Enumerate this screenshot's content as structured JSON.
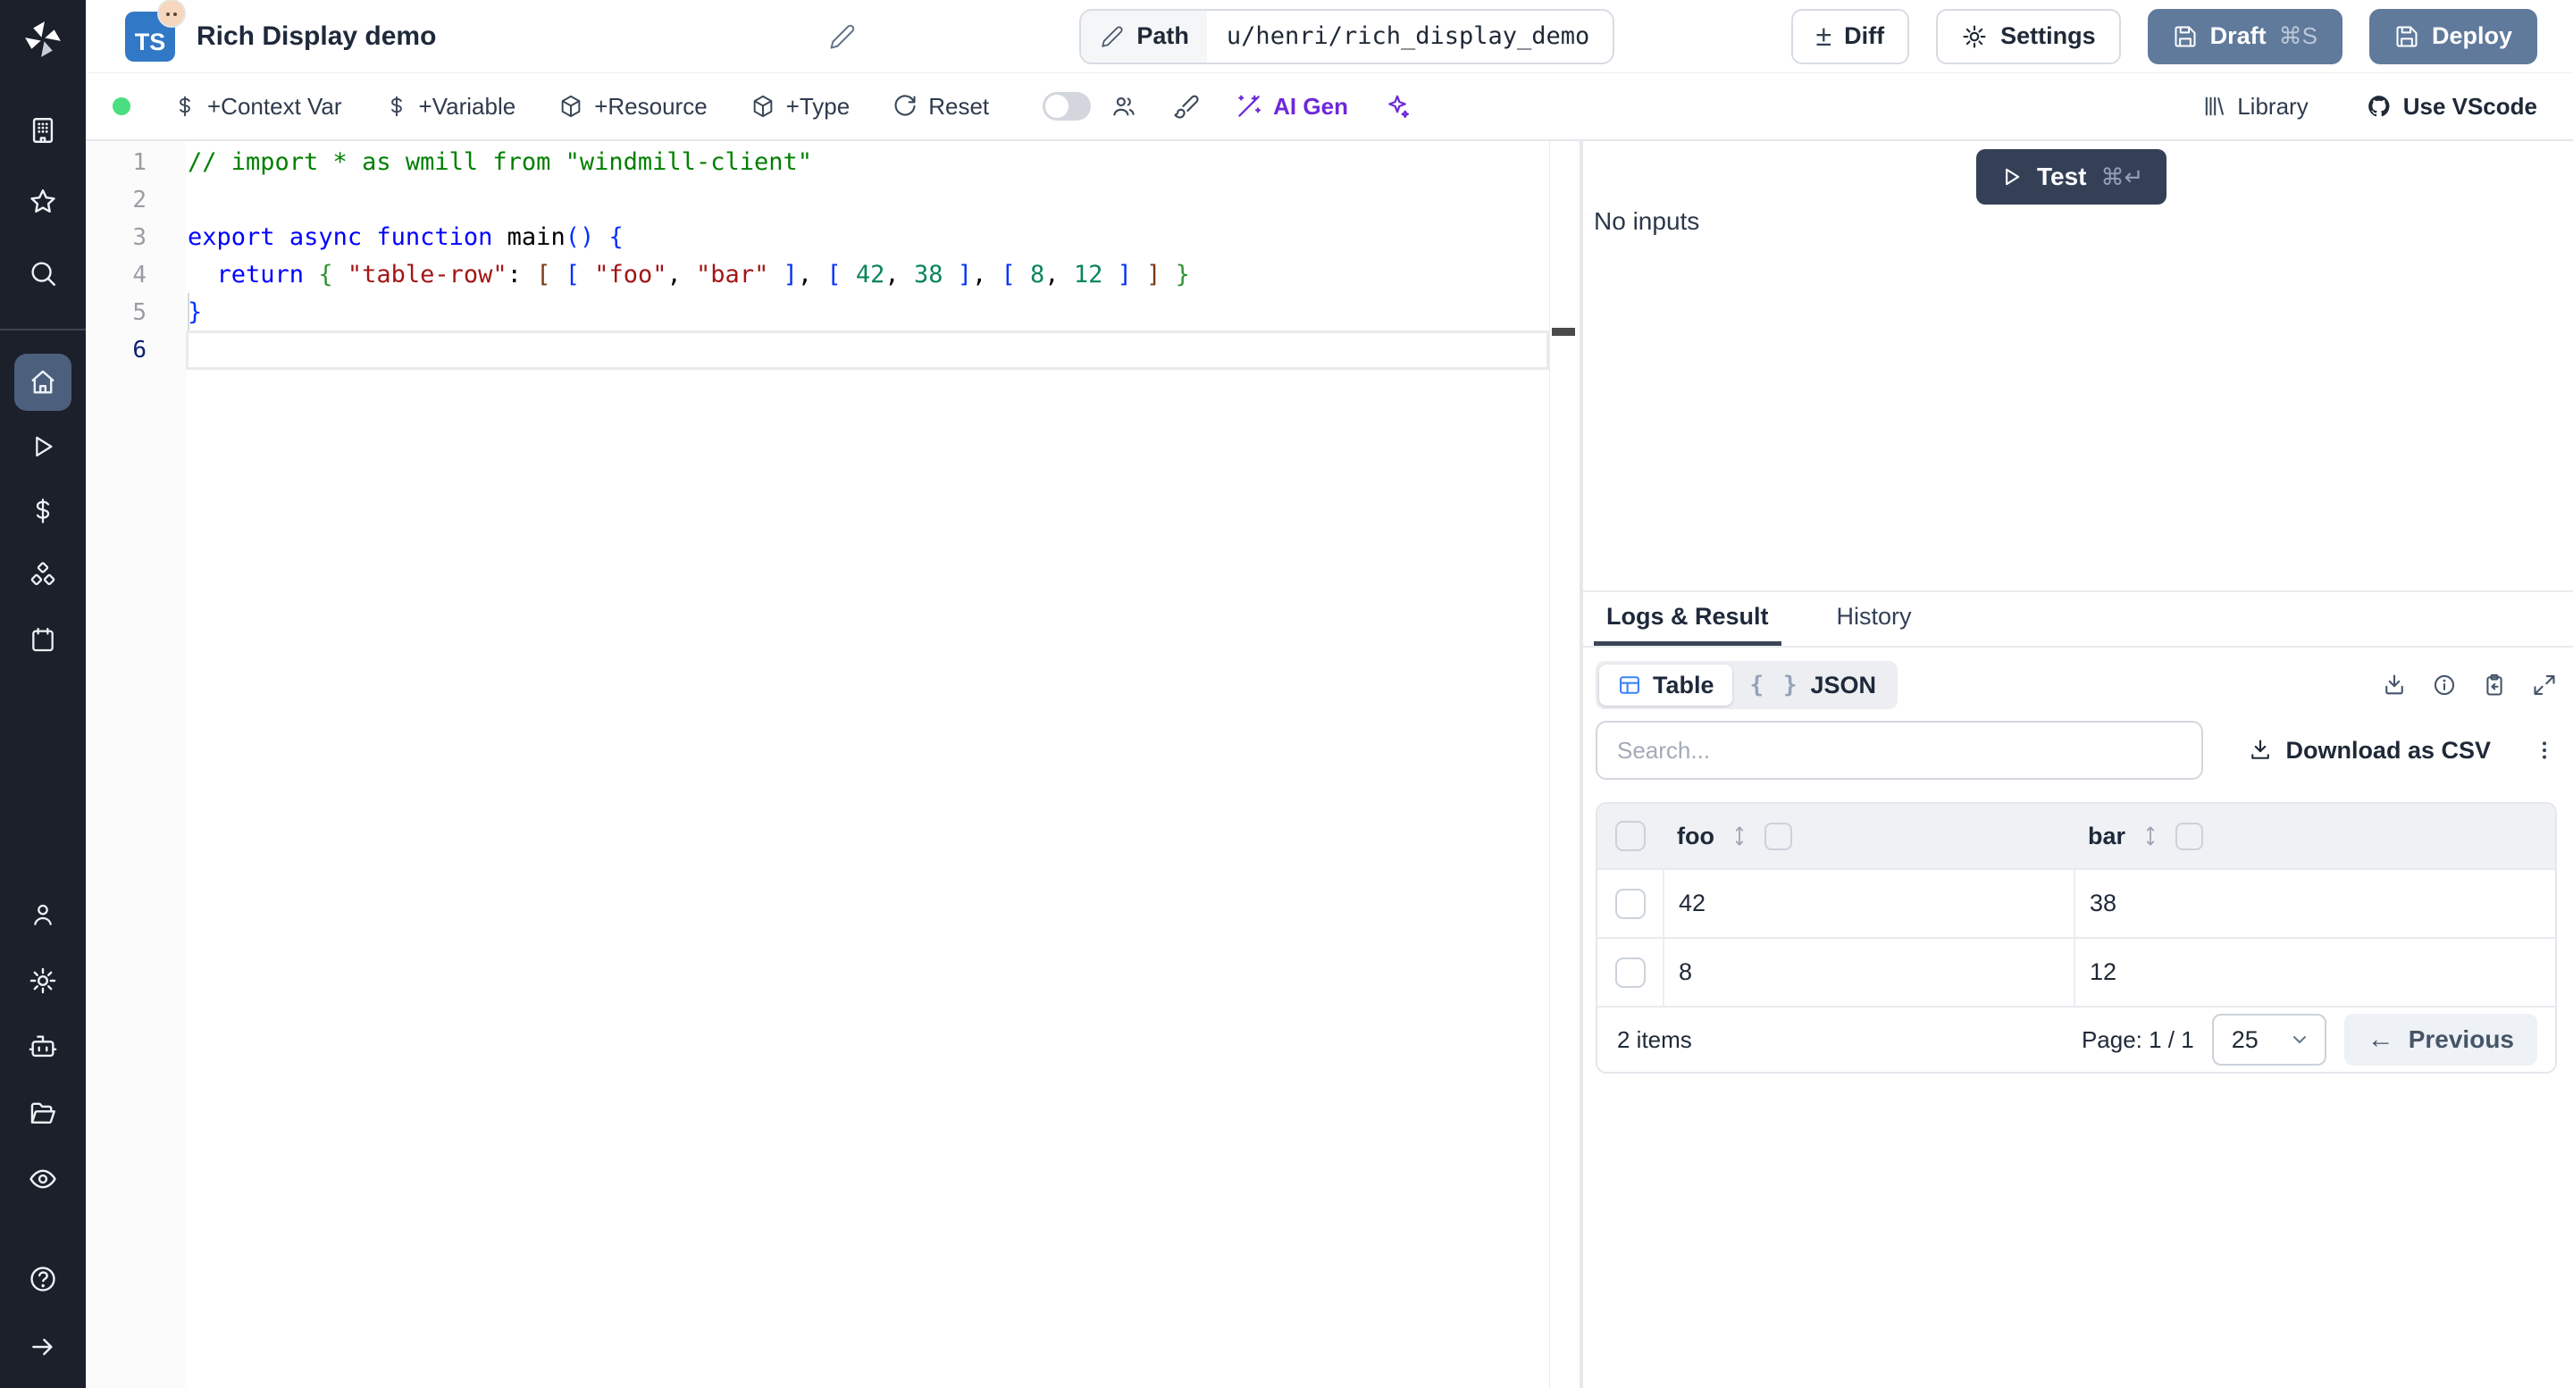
{
  "topbar": {
    "language_badge": "TS",
    "title": "Rich Display demo",
    "path_label": "Path",
    "path_value": "u/henri/rich_display_demo",
    "diff_label": "Diff",
    "settings_label": "Settings",
    "draft_label": "Draft",
    "draft_shortcut": "⌘S",
    "deploy_label": "Deploy"
  },
  "toolbar": {
    "status_color": "#4ade80",
    "context_var_label": "+Context Var",
    "variable_label": "+Variable",
    "resource_label": "+Resource",
    "type_label": "+Type",
    "reset_label": "Reset",
    "ai_gen_label": "AI Gen",
    "ai_accent_color": "#6d28d9",
    "library_label": "Library",
    "vscode_label": "Use VScode"
  },
  "sidebar": {
    "icons": [
      "windmill-logo",
      "building",
      "star",
      "search",
      "home",
      "play",
      "boxes",
      "dollar",
      "calendar",
      "user",
      "gear",
      "bot",
      "folder-open",
      "eye",
      "help-circle",
      "arrow-right"
    ],
    "active_item": "home",
    "active_color": "#4c5f7d"
  },
  "editor": {
    "line_numbers": [
      "1",
      "2",
      "3",
      "4",
      "5",
      "6"
    ],
    "active_line": "6",
    "lines": [
      [
        {
          "t": "// import * as wmill from \"windmill-client\"",
          "c": "tok-comment"
        }
      ],
      [],
      [
        {
          "t": "export",
          "c": "tok-kw"
        },
        {
          "t": " ",
          "c": ""
        },
        {
          "t": "async",
          "c": "tok-kw"
        },
        {
          "t": " ",
          "c": ""
        },
        {
          "t": "function",
          "c": "tok-kw"
        },
        {
          "t": " ",
          "c": ""
        },
        {
          "t": "main",
          "c": "tok-id"
        },
        {
          "t": "()",
          "c": "tok-b1"
        },
        {
          "t": " ",
          "c": ""
        },
        {
          "t": "{",
          "c": "tok-b1"
        }
      ],
      [
        {
          "t": "  ",
          "c": ""
        },
        {
          "t": "return",
          "c": "tok-kw"
        },
        {
          "t": " ",
          "c": ""
        },
        {
          "t": "{",
          "c": "tok-b2"
        },
        {
          "t": " ",
          "c": ""
        },
        {
          "t": "\"table-row\"",
          "c": "tok-str"
        },
        {
          "t": ": ",
          "c": ""
        },
        {
          "t": "[",
          "c": "tok-b3"
        },
        {
          "t": " ",
          "c": ""
        },
        {
          "t": "[",
          "c": "tok-b1"
        },
        {
          "t": " ",
          "c": ""
        },
        {
          "t": "\"foo\"",
          "c": "tok-str"
        },
        {
          "t": ", ",
          "c": ""
        },
        {
          "t": "\"bar\"",
          "c": "tok-str"
        },
        {
          "t": " ",
          "c": ""
        },
        {
          "t": "]",
          "c": "tok-b1"
        },
        {
          "t": ", ",
          "c": ""
        },
        {
          "t": "[",
          "c": "tok-b1"
        },
        {
          "t": " ",
          "c": ""
        },
        {
          "t": "42",
          "c": "tok-num"
        },
        {
          "t": ", ",
          "c": ""
        },
        {
          "t": "38",
          "c": "tok-num"
        },
        {
          "t": " ",
          "c": ""
        },
        {
          "t": "]",
          "c": "tok-b1"
        },
        {
          "t": ", ",
          "c": ""
        },
        {
          "t": "[",
          "c": "tok-b1"
        },
        {
          "t": " ",
          "c": ""
        },
        {
          "t": "8",
          "c": "tok-num"
        },
        {
          "t": ", ",
          "c": ""
        },
        {
          "t": "12",
          "c": "tok-num"
        },
        {
          "t": " ",
          "c": ""
        },
        {
          "t": "]",
          "c": "tok-b1"
        },
        {
          "t": " ",
          "c": ""
        },
        {
          "t": "]",
          "c": "tok-b3"
        },
        {
          "t": " ",
          "c": ""
        },
        {
          "t": "}",
          "c": "tok-b2"
        }
      ],
      [
        {
          "t": "}",
          "c": "tok-b1"
        }
      ],
      []
    ]
  },
  "run": {
    "test_label": "Test",
    "test_shortcut": "⌘↵",
    "no_inputs_text": "No inputs",
    "test_button_color": "#344056"
  },
  "result_panel": {
    "tabs": [
      {
        "label": "Logs & Result",
        "active": true
      },
      {
        "label": "History",
        "active": false
      }
    ],
    "view_toggle": {
      "table_label": "Table",
      "json_label": "JSON",
      "json_braces": "{ }",
      "table_icon_color": "#3b82f6"
    },
    "search_placeholder": "Search...",
    "download_csv_label": "Download as CSV",
    "table": {
      "columns": [
        "foo",
        "bar"
      ],
      "rows": [
        {
          "foo": "42",
          "bar": "38"
        },
        {
          "foo": "8",
          "bar": "12"
        }
      ],
      "items_label": "2 items",
      "page_label": "Page: 1 / 1",
      "page_size_value": "25",
      "previous_label": "Previous",
      "previous_arrow": "←"
    }
  }
}
